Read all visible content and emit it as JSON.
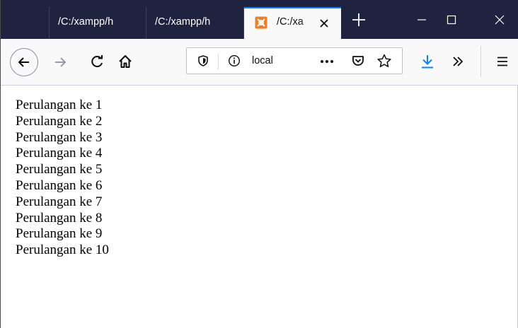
{
  "tabs": [
    {
      "title": "/C:/xampp/h"
    },
    {
      "title": "/C:/xampp/h"
    },
    {
      "title": "/C:/xa",
      "active": true,
      "favicon": "xampp-icon"
    }
  ],
  "icons": {
    "new_tab": "plus-icon",
    "minimize": "minimize-icon",
    "maximize": "maximize-icon",
    "close": "close-icon",
    "back": "back-arrow-icon",
    "forward": "forward-arrow-icon",
    "reload": "reload-icon",
    "home": "home-icon",
    "tracking": "shield-icon",
    "info": "info-icon",
    "page_actions": "more-icon",
    "pocket": "pocket-icon",
    "bookmark": "star-icon",
    "downloads": "download-icon",
    "overflow": "chevrons-right-icon",
    "menu": "hamburger-icon"
  },
  "urlbar": {
    "text": "local"
  },
  "colors": {
    "tabstrip": "#202340",
    "active_tab_accent": "#0a84ff",
    "toolbar": "#f9f9fa",
    "download_icon": "#0a84ff",
    "xampp_orange": "#f37b21"
  },
  "content": {
    "lines": [
      "Perulangan ke 1",
      "Perulangan ke 2",
      "Perulangan ke 3",
      "Perulangan ke 4",
      "Perulangan ke 5",
      "Perulangan ke 6",
      "Perulangan ke 7",
      "Perulangan ke 8",
      "Perulangan ke 9",
      "Perulangan ke 10"
    ]
  }
}
